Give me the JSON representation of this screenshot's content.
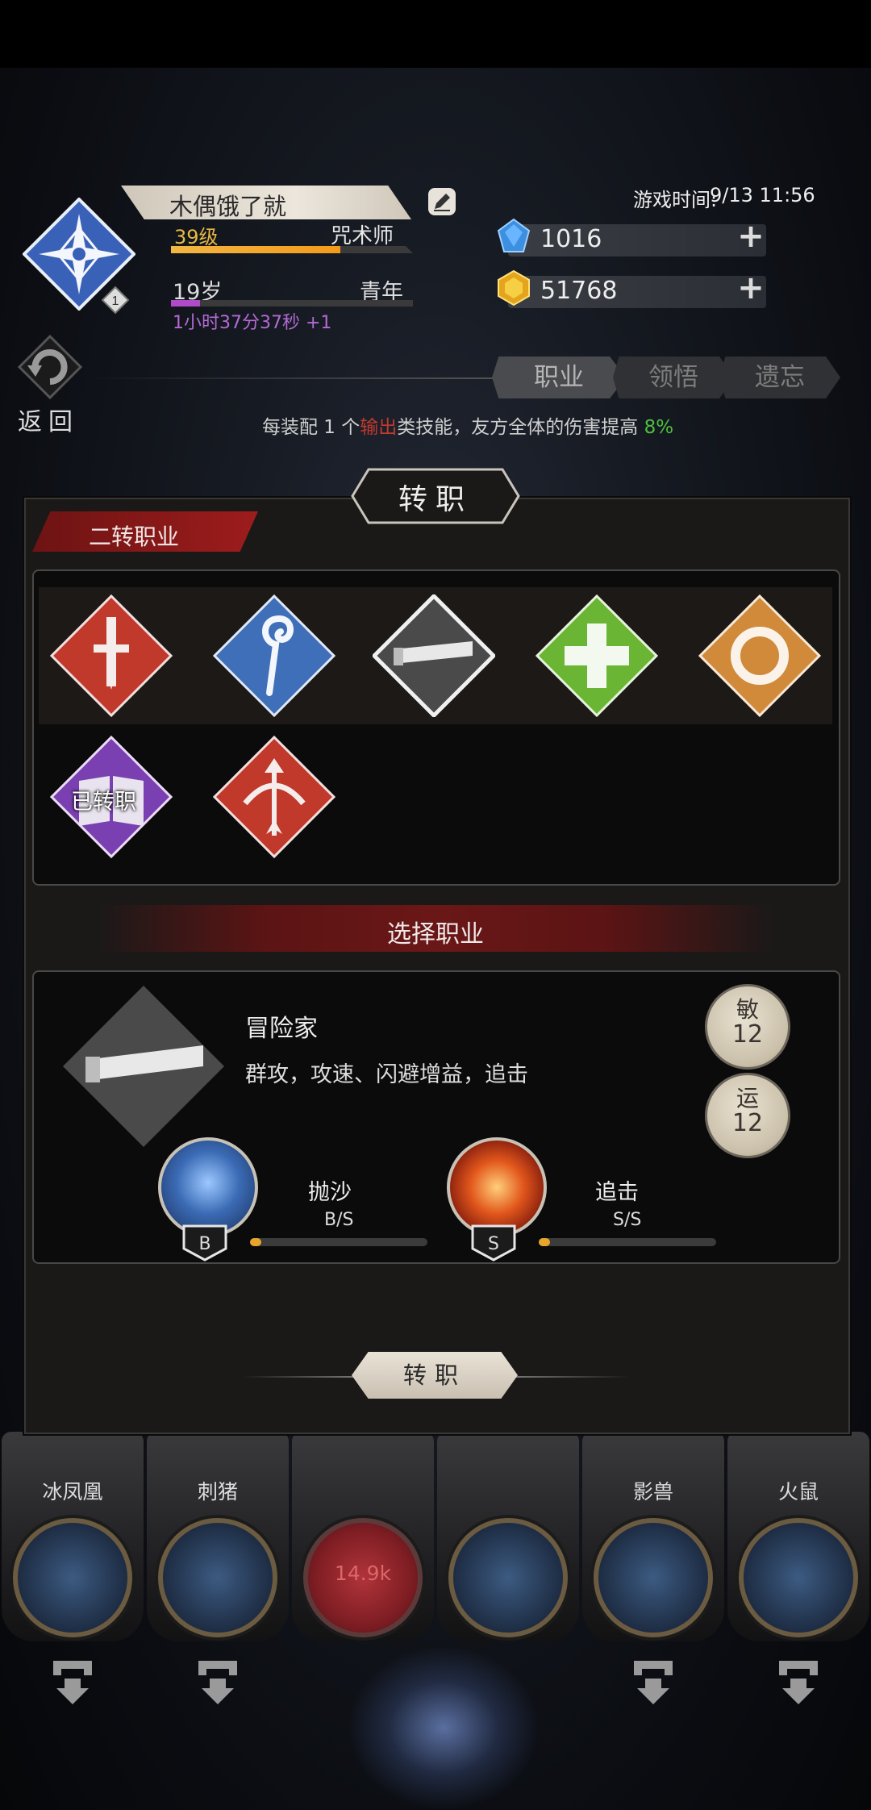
{
  "player": {
    "name": "木偶饿了就",
    "level_badge": "1",
    "level": "39级",
    "class": "咒术师",
    "exp_fraction": 0.7,
    "age": "19岁",
    "life_stage": "青年",
    "age_fraction": 0.12,
    "play_time": "1小时37分37秒 +1"
  },
  "game_time": {
    "label": "游戏时间:",
    "value": "9/13 11:56"
  },
  "resources": {
    "diamond": "1016",
    "gold": "51768"
  },
  "nav": {
    "return_label": "返回"
  },
  "tabs": [
    {
      "label": "职业",
      "active": true
    },
    {
      "label": "领悟",
      "active": false
    },
    {
      "label": "遗忘",
      "active": false
    }
  ],
  "bonus": {
    "prefix": "每装配 1 个",
    "highlight": "输出",
    "middle": "类技能，友方全体的伤害提高 ",
    "value": "8%"
  },
  "panel": {
    "title": "转职",
    "section_title": "二转职业",
    "completed_label": "已转职",
    "select_title": "选择职业",
    "confirm_label": "转职"
  },
  "jobs": [
    {
      "icon": "sword-icon",
      "color": "#c0392b"
    },
    {
      "icon": "staff-icon",
      "color": "#3f6fb8"
    },
    {
      "icon": "telescope-icon",
      "color": "#4a4a4a"
    },
    {
      "icon": "cross-icon",
      "color": "#6ab533"
    },
    {
      "icon": "ring-icon",
      "color": "#d08a3a"
    },
    {
      "icon": "book-icon",
      "color": "#7a3fb0"
    },
    {
      "icon": "bow-icon",
      "color": "#c0392b"
    }
  ],
  "selected_job": {
    "name": "冒险家",
    "description": "群攻，攻速、闪避增益，追击",
    "stats": [
      {
        "key": "敏",
        "value": "12"
      },
      {
        "key": "运",
        "value": "12"
      }
    ],
    "skills": [
      {
        "name": "抛沙",
        "grade": "B/S",
        "rank": "B",
        "progress": 0.06,
        "icon": "sand-throw-icon"
      },
      {
        "name": "追击",
        "grade": "S/S",
        "rank": "S",
        "progress": 0.06,
        "icon": "pursuit-icon"
      }
    ]
  },
  "bottom_skills": [
    {
      "name": "冰凤凰",
      "icon": "ice-phoenix-icon"
    },
    {
      "name": "刺猪",
      "icon": "quill-icon"
    },
    {
      "name": "",
      "value": "14.9k",
      "icon": "empty-slot-icon"
    },
    {
      "name": "",
      "icon": "dagger-icon"
    },
    {
      "name": "影兽",
      "icon": "shadow-beast-icon"
    },
    {
      "name": "火鼠",
      "icon": "fire-rat-icon"
    }
  ],
  "colors": {
    "accent_red": "#9e1c1c",
    "exp_orange": "#f49a19",
    "age_purple": "#b04ac8",
    "bonus_green": "#4fbf3e"
  }
}
